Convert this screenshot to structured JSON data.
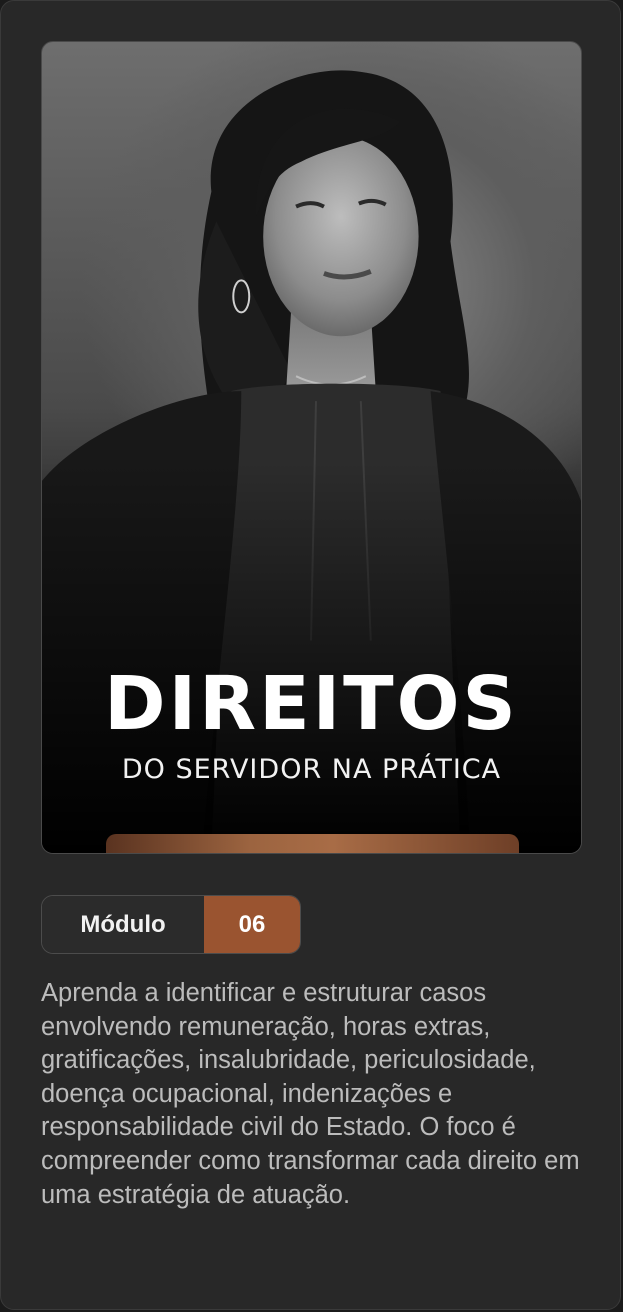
{
  "cover": {
    "title": "DIREITOS",
    "subtitle": "DO SERVIDOR NA PRÁTICA"
  },
  "module": {
    "label": "Módulo",
    "number": "06"
  },
  "description": "Aprenda a identificar e estruturar casos envolvendo remuneração, horas extras, gratificações, insalubridade, periculosidade, doença ocupacional, indenizações e responsabilidade civil do Estado. O foco é compreender como transformar cada direito em uma estratégia de atuação.",
  "colors": {
    "card_background": "#282828",
    "accent": "#9a5430",
    "text_primary": "#ffffff",
    "text_secondary": "#bcbcbc"
  }
}
